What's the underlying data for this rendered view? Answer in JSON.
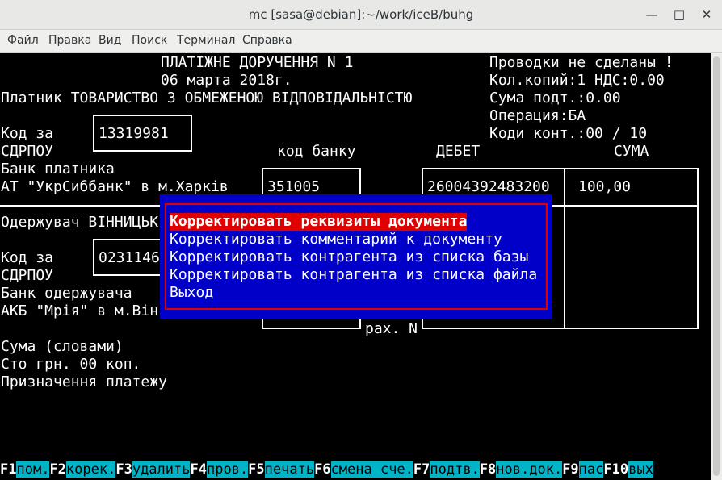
{
  "window": {
    "title": "mc [sasa@debian]:~/work/iceB/buhg",
    "minimize": "—",
    "maximize": "□",
    "close": "✕"
  },
  "menu": [
    "Файл",
    "Правка",
    "Вид",
    "Поиск",
    "Терминал",
    "Справка"
  ],
  "doc": {
    "header_title": "ПЛАТІЖНЕ ДОРУЧЕННЯ N 1",
    "header_date": "06 марта 2018г.",
    "payer_line": "Платник ТОВАРИСТВО З ОБМЕЖЕНОЮ ВІДПОВІДАЛЬНІСТЮ",
    "status": "Проводки не сделаны !",
    "copies": "Кол.копий:1 НДС:0.00",
    "sum_sub": "Сума подт.:0.00",
    "operation": "Операция:БА",
    "codes": "Коди конт.:00 / 10",
    "code_label_1": "Код за",
    "code_label_2": "СДРПОУ",
    "payer_code": "13319981",
    "bank_code_label": "код банку",
    "debit_label": "ДЕБЕТ",
    "sum_label": "СУМА",
    "payer_bank_label": "Банк платника",
    "payer_bank": "АТ \"УкрСиббанк\" в м.Харків",
    "payer_bank_code": "351005",
    "debit_account": "26004392483200",
    "amount": "100,00",
    "recipient_line": "Одержувач ВІННИЦЬК",
    "recipient_code": "0231146",
    "recipient_bank_label": "Банк одержувача",
    "recipient_bank": "АКБ \"Мрія\" в м.Він",
    "account_no_label": "рах. N",
    "sum_words_label": "Сума (словами)",
    "sum_words": "Сто грн. 00 коп.",
    "purpose_label": "Призначення платежу"
  },
  "popup": {
    "items": [
      "Корректировать реквизиты документа",
      "Корректировать комментарий к документу",
      "Корректировать контрагента из списка базы",
      "Корректировать контрагента из списка файла",
      "Выход"
    ],
    "selected_index": 0
  },
  "fkeys": [
    {
      "key": "F1",
      "label": "пом."
    },
    {
      "key": "F2",
      "label": "корек."
    },
    {
      "key": "F3",
      "label": "удалить"
    },
    {
      "key": "F4",
      "label": "пров."
    },
    {
      "key": "F5",
      "label": "печать"
    },
    {
      "key": "F6",
      "label": "смена сче."
    },
    {
      "key": "F7",
      "label": "подтв."
    },
    {
      "key": "F8",
      "label": "нов.док."
    },
    {
      "key": "F9",
      "label": "пас"
    },
    {
      "key": "F10",
      "label": "вых"
    }
  ],
  "colors": {
    "popup_bg": "#0000c8",
    "popup_frame": "#e00000",
    "fkey_label_bg": "#00b4c8"
  }
}
